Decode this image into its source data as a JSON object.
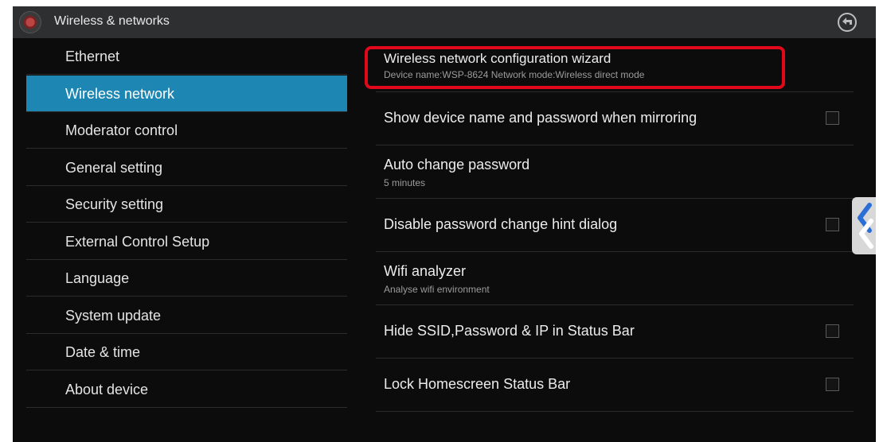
{
  "header": {
    "title": "Wireless & networks"
  },
  "sidebar": {
    "items": [
      {
        "label": "Ethernet"
      },
      {
        "label": "Wireless network"
      },
      {
        "label": "Moderator control"
      },
      {
        "label": "General setting"
      },
      {
        "label": "Security setting"
      },
      {
        "label": "External Control Setup"
      },
      {
        "label": "Language"
      },
      {
        "label": "System update"
      },
      {
        "label": "Date & time"
      },
      {
        "label": "About device"
      }
    ],
    "active_index": 1
  },
  "settings": [
    {
      "title": "Wireless network configuration wizard",
      "summary": "Device name:WSP-8624   Network mode:Wireless direct mode",
      "highlighted": true
    },
    {
      "title": "Show device name and password when mirroring",
      "checkbox": false
    },
    {
      "title": "Auto change password",
      "summary": "5 minutes"
    },
    {
      "title": "Disable password change hint dialog",
      "checkbox": false
    },
    {
      "title": "Wifi analyzer",
      "summary": "Analyse wifi environment"
    },
    {
      "title": "Hide SSID,Password & IP in Status Bar",
      "checkbox": false
    },
    {
      "title": "Lock Homescreen Status Bar",
      "checkbox": false
    }
  ],
  "colors": {
    "accent": "#1d86b3",
    "highlight": "#e0081a",
    "background": "#0c0c0c",
    "titlebar": "#2e2f31"
  },
  "icons": {
    "app": "settings-app-icon",
    "back": "back-icon",
    "handle": "chevron-left-icon"
  }
}
